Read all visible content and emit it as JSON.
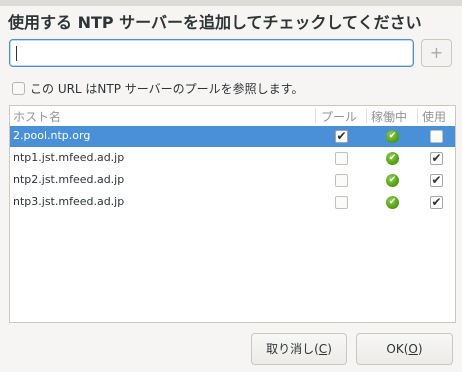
{
  "dialog": {
    "title": "使用する NTP サーバーを追加してチェックしてください",
    "input": {
      "value": "",
      "placeholder": ""
    },
    "add_button": "+",
    "pool_checkbox": {
      "label": "この URL はNTP サーバーのプールを参照します。",
      "checked": false
    }
  },
  "table": {
    "columns": {
      "host": "ホスト名",
      "pool": "プール",
      "status": "稼働中",
      "use": "使用"
    },
    "rows": [
      {
        "host": "2.pool.ntp.org",
        "pool": true,
        "status": "ok",
        "use": false,
        "selected": true
      },
      {
        "host": "ntp1.jst.mfeed.ad.jp",
        "pool": false,
        "status": "ok",
        "use": true,
        "selected": false
      },
      {
        "host": "ntp2.jst.mfeed.ad.jp",
        "pool": false,
        "status": "ok",
        "use": true,
        "selected": false
      },
      {
        "host": "ntp3.jst.mfeed.ad.jp",
        "pool": false,
        "status": "ok",
        "use": true,
        "selected": false
      }
    ]
  },
  "buttons": {
    "cancel": {
      "label": "取り消し(",
      "mnemonic": "C",
      "suffix": ")"
    },
    "ok": {
      "label": "OK(",
      "mnemonic": "O",
      "suffix": ")"
    }
  },
  "icons": {
    "add": "plus-icon",
    "check": "check-icon",
    "status_ok": "status-ok-icon"
  },
  "colors": {
    "selection": "#4a90d9",
    "status_ok": "#4e9a06"
  }
}
